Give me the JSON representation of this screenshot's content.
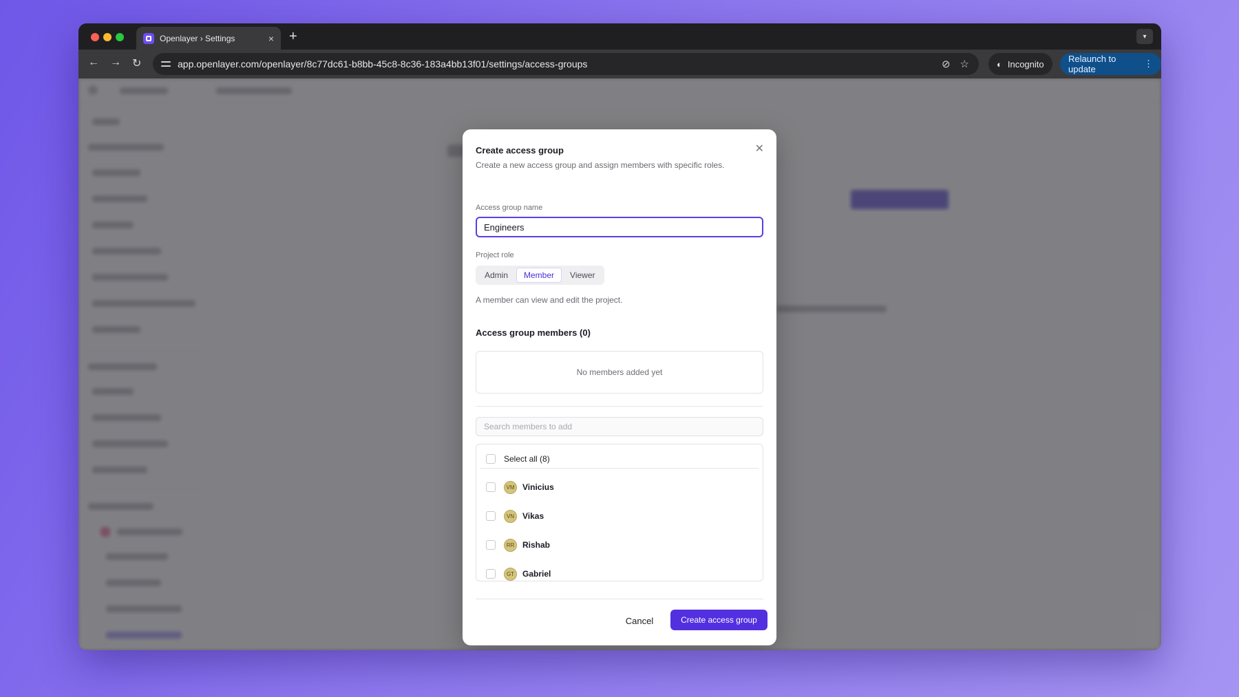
{
  "browser": {
    "tab_title": "Openlayer › Settings",
    "tab_close": "×",
    "new_tab": "+",
    "url": "app.openlayer.com/openlayer/8c77dc61-b8bb-45c8-8c36-183a4bb13f01/settings/access-groups",
    "incognito_label": "Incognito",
    "relaunch_label": "Relaunch to update"
  },
  "modal": {
    "title": "Create access group",
    "subtitle": "Create a new access group and assign members with specific roles.",
    "close_glyph": "✕",
    "name_label": "Access group name",
    "name_value": "Engineers",
    "role_label": "Project role",
    "roles": [
      "Admin",
      "Member",
      "Viewer"
    ],
    "selected_role": "Member",
    "role_hint": "A member can view and edit the project.",
    "members_heading": "Access group members (0)",
    "empty_text": "No members added yet",
    "search_placeholder": "Search members to add",
    "select_all_label": "Select all (8)",
    "members": [
      {
        "initials": "VM",
        "name": "Vinicius"
      },
      {
        "initials": "VN",
        "name": "Vikas"
      },
      {
        "initials": "RR",
        "name": "Rishab"
      },
      {
        "initials": "GT",
        "name": "Gabriel"
      }
    ],
    "cancel_label": "Cancel",
    "create_label": "Create access group"
  },
  "colors": {
    "accent": "#5230e0",
    "input_border": "#5a3de6",
    "avatar_bg": "#d4c47c",
    "relaunch_bg": "#0f4f8a"
  }
}
